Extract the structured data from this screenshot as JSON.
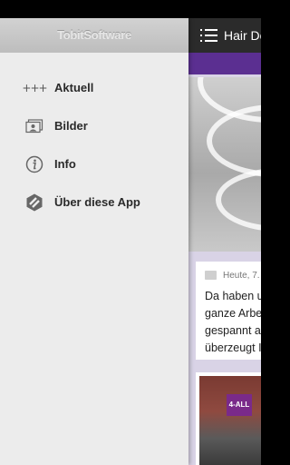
{
  "drawer": {
    "brand": "TobitSoftware",
    "items": [
      {
        "label": "Aktuell",
        "icon": "plus-icon"
      },
      {
        "label": "Bilder",
        "icon": "gallery-icon"
      },
      {
        "label": "Info",
        "icon": "info-icon"
      },
      {
        "label": "Über diese App",
        "icon": "chayns-logo-icon"
      }
    ]
  },
  "app": {
    "title": "Hair Do",
    "card": {
      "date": "Heute, 7.",
      "lines": [
        "Da haben u",
        "ganze Arbe",
        "gespannt a",
        "überzeugt I"
      ]
    },
    "photo_sign": "4-ALL"
  },
  "colors": {
    "toolbar": "#2b2b2b",
    "accent": "#5b2f91",
    "drawer_bg": "#ececec",
    "list_bg": "#d9d3e6"
  }
}
